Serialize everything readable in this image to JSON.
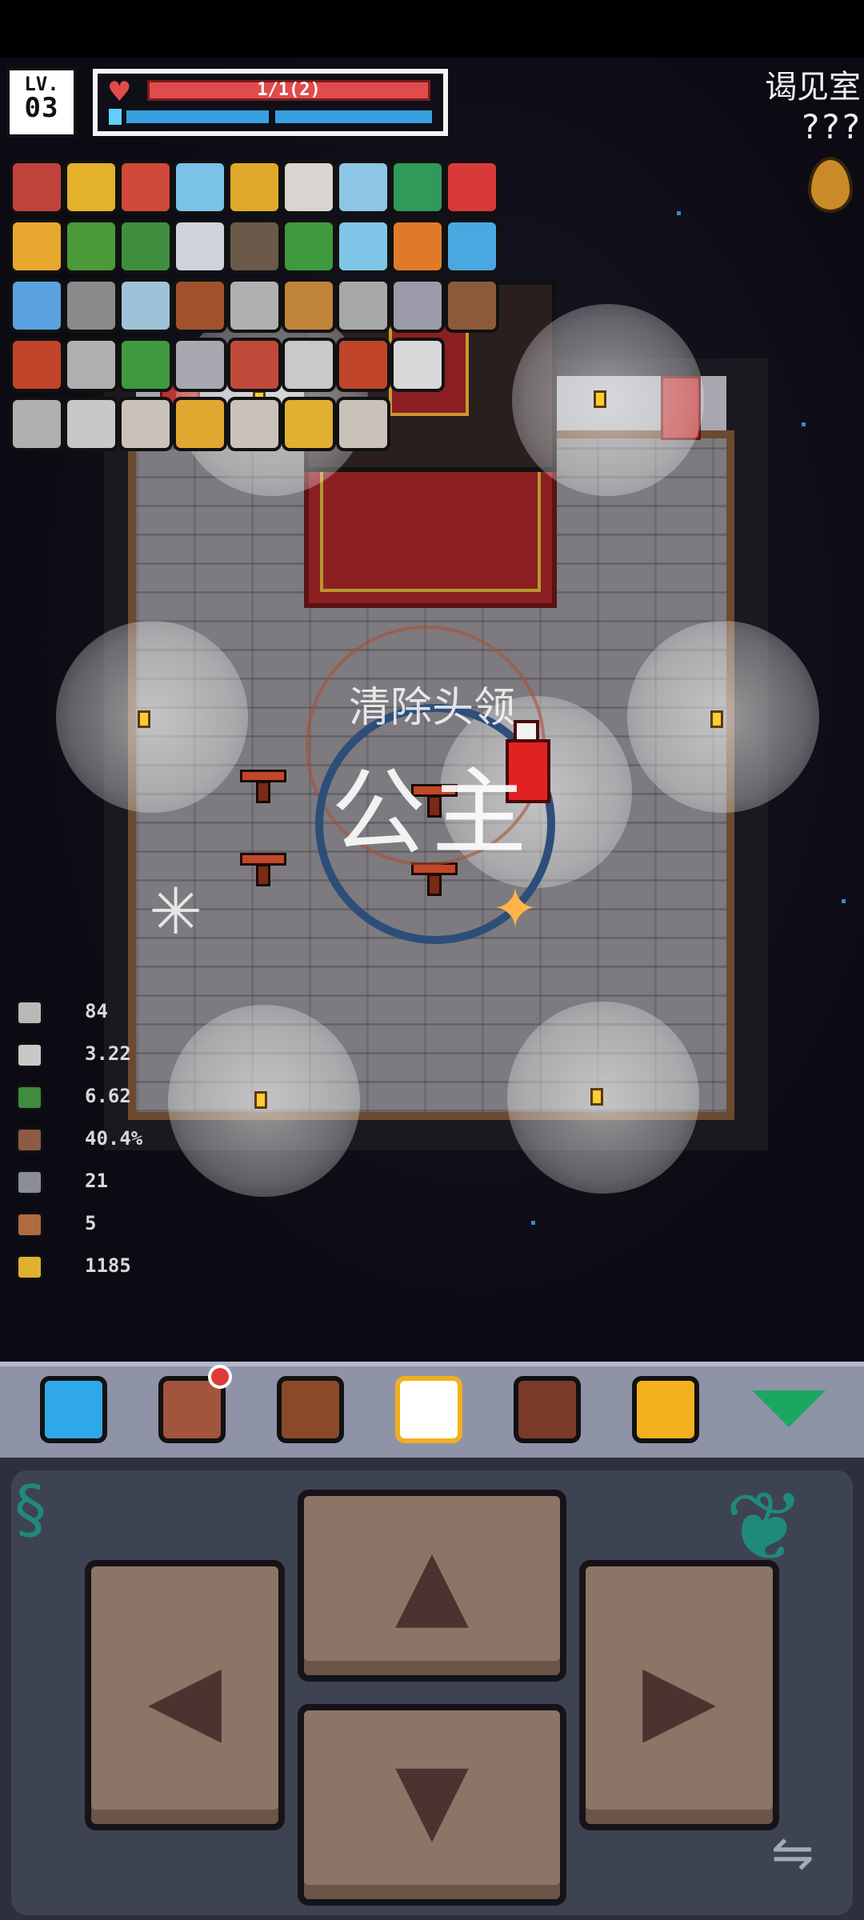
{
  "hud": {
    "level_label": "LV.",
    "level": "03",
    "health_text": "1/1(2)"
  },
  "room": {
    "name": "谒见室",
    "subtitle": "???"
  },
  "objective": {
    "title": "清除头领",
    "target": "公主"
  },
  "stats": [
    {
      "icon": "attack-icon",
      "value": "84",
      "color": "#b9b9b9"
    },
    {
      "icon": "attack-speed-icon",
      "value": "3.22",
      "color": "#c8c8c8"
    },
    {
      "icon": "speed-boot-icon",
      "value": "6.62",
      "color": "#3f8b3f"
    },
    {
      "icon": "shield-icon",
      "value": "40.4%",
      "color": "#8e5a44"
    },
    {
      "icon": "silver-key-icon",
      "value": "21",
      "color": "#8a8e98"
    },
    {
      "icon": "bronze-key-icon",
      "value": "5",
      "color": "#b06c40"
    },
    {
      "icon": "gold-coin-icon",
      "value": "1185",
      "color": "#e0b030"
    }
  ],
  "inventory": [
    {
      "icon": "helmet-icon",
      "color": "#c1443a"
    },
    {
      "icon": "sunflower-icon",
      "color": "#e3b22a"
    },
    {
      "icon": "compass-icon",
      "color": "#d04a3a"
    },
    {
      "icon": "potion-flask-icon",
      "color": "#7bc2e8"
    },
    {
      "icon": "golden-crest-icon",
      "color": "#e0a82a"
    },
    {
      "icon": "red-goblet-icon",
      "color": "#d8d4cf"
    },
    {
      "icon": "blue-flask-icon",
      "color": "#8dc6e6"
    },
    {
      "icon": "green-tome-icon",
      "color": "#2f9a5a"
    },
    {
      "icon": "red-heart-icon",
      "color": "#d83a3a"
    },
    {
      "icon": "star-amulet-icon",
      "color": "#e8a830"
    },
    {
      "icon": "green-snake-icon",
      "color": "#4a9a3a"
    },
    {
      "icon": "green-boot-icon",
      "color": "#3f8f3f"
    },
    {
      "icon": "cloud-icon",
      "color": "#cfd3dc"
    },
    {
      "icon": "lantern-icon",
      "color": "#6b5a4a"
    },
    {
      "icon": "green-wand-icon",
      "color": "#3f9a3f"
    },
    {
      "icon": "ice-crystal-icon",
      "color": "#7fc6e8"
    },
    {
      "icon": "lightning-icon",
      "color": "#e07a2a"
    },
    {
      "icon": "blue-heart-icon",
      "color": "#4aa8e0"
    },
    {
      "icon": "blue-gem-icon",
      "color": "#5aa2e0"
    },
    {
      "icon": "stone-icon",
      "color": "#8a8a8a"
    },
    {
      "icon": "armor-icon",
      "color": "#9fc2d8"
    },
    {
      "icon": "bread-icon",
      "color": "#a0522d"
    },
    {
      "icon": "dagger-icon",
      "color": "#b0b0b0"
    },
    {
      "icon": "acorn-icon",
      "color": "#c0853a"
    },
    {
      "icon": "feather-icon",
      "color": "#a8a8a8"
    },
    {
      "icon": "spiky-shell-icon",
      "color": "#9a9aa8"
    },
    {
      "icon": "claw-icon",
      "color": "#8a5a3a"
    },
    {
      "icon": "red-feather-icon",
      "color": "#c0452a"
    },
    {
      "icon": "sword-icon",
      "color": "#b0b0b0"
    },
    {
      "icon": "clover-icon",
      "color": "#3f9a3f"
    },
    {
      "icon": "silver-goblet-icon",
      "color": "#a8a8b0"
    },
    {
      "icon": "mushroom-icon",
      "color": "#c04a3a"
    },
    {
      "icon": "fan-icon",
      "color": "#c9c9c9"
    },
    {
      "icon": "red-whip-icon",
      "color": "#c0452a"
    },
    {
      "icon": "blank-scroll-icon",
      "color": "#d8d8d8"
    },
    {
      "icon": "spear-icon",
      "color": "#b0b0b0"
    },
    {
      "icon": "shell-icon",
      "color": "#c8c8c8"
    },
    {
      "icon": "jar-icon",
      "color": "#c9c2bb"
    },
    {
      "icon": "boot-icon",
      "color": "#e0a830"
    },
    {
      "icon": "empty-jar-icon",
      "color": "#c9c2bb"
    },
    {
      "icon": "key-icon",
      "color": "#e0b030"
    },
    {
      "icon": "small-jar-icon",
      "color": "#c9c2bb"
    }
  ],
  "toolbar": [
    {
      "name": "character-button",
      "icon": "character-icon",
      "color": "#2fa8e8",
      "badge": false
    },
    {
      "name": "journal-button",
      "icon": "book-icon",
      "color": "#a2553a",
      "badge": true
    },
    {
      "name": "bag-button",
      "icon": "bag-icon",
      "color": "#8a4a2a",
      "badge": false
    },
    {
      "name": "map-button",
      "icon": "map-focus-icon",
      "color": "#ffffff",
      "badge": false,
      "active": true
    },
    {
      "name": "search-button",
      "icon": "magnifier-icon",
      "color": "#7a3a2a",
      "badge": false
    },
    {
      "name": "pause-button",
      "icon": "pause-icon",
      "color": "#f2b01e",
      "badge": false
    },
    {
      "name": "collapse-button",
      "icon": "triangle-down-icon",
      "color": "#1aa860",
      "badge": false
    }
  ],
  "controls": {
    "up": "▲",
    "down": "▼",
    "left": "◀",
    "right": "▶"
  },
  "colors": {
    "health": "#e04b4b",
    "mana": "#3a9fe0",
    "toolbar": "#8e93a8",
    "pad": "#8c7566"
  }
}
